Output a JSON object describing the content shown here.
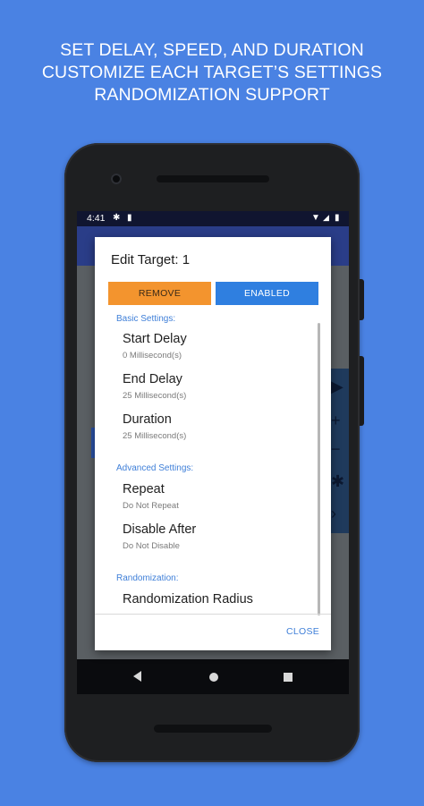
{
  "headline": {
    "line1": "SET DELAY, SPEED, AND DURATION",
    "line2": "CUSTOMIZE EACH TARGET’S SETTINGS",
    "line3": "RANDOMIZATION SUPPORT"
  },
  "status_bar": {
    "time": "4:41",
    "left_icons": [
      "gear-icon",
      "sd-card-icon"
    ],
    "right_icons": [
      "wifi-icon",
      "signal-icon",
      "battery-icon"
    ]
  },
  "dialog": {
    "title": "Edit Target: 1",
    "remove_label": "REMOVE",
    "enabled_label": "ENABLED",
    "sections": {
      "basic": {
        "label": "Basic Settings:",
        "items": [
          {
            "title": "Start Delay",
            "value": "0 Millisecond(s)"
          },
          {
            "title": "End Delay",
            "value": "25 Millisecond(s)"
          },
          {
            "title": "Duration",
            "value": "25 Millisecond(s)"
          }
        ]
      },
      "advanced": {
        "label": "Advanced Settings:",
        "items": [
          {
            "title": "Repeat",
            "value": "Do Not Repeat"
          },
          {
            "title": "Disable After",
            "value": "Do Not Disable"
          }
        ]
      },
      "randomization": {
        "label": "Randomization:",
        "items": [
          {
            "title": "Randomization Radius",
            "value": ""
          }
        ]
      }
    },
    "close_label": "CLOSE"
  },
  "colors": {
    "background": "#4a82e3",
    "remove_button": "#f3942e",
    "enabled_button": "#2f7fe0",
    "accent_text": "#3f7fd8"
  }
}
